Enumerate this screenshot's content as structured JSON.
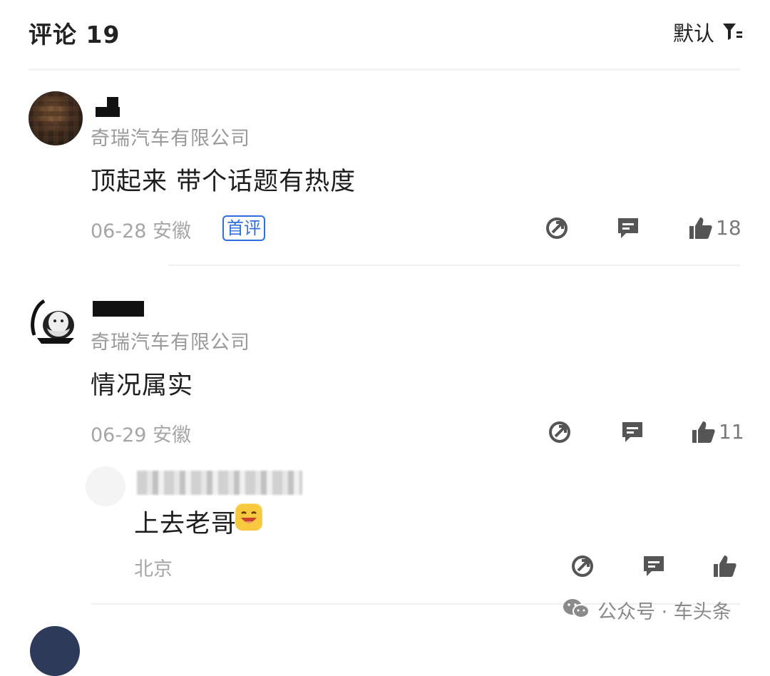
{
  "header": {
    "title": "评论 19",
    "sort_label": "默认"
  },
  "comments": [
    {
      "company": "奇瑞汽车有限公司",
      "text": "顶起来 带个话题有热度",
      "date_location": "06-28 安徽",
      "badge": "首评",
      "likes": "18"
    },
    {
      "company": "奇瑞汽车有限公司",
      "text": "情况属实",
      "date_location": "06-29 安徽",
      "likes": "11",
      "reply": {
        "text": "上去老哥",
        "location": "北京"
      }
    }
  ],
  "watermark": {
    "text": "公众号 · 车头条"
  },
  "colors": {
    "badge": "#2f6fe0",
    "meta": "#a6a6a6",
    "icon": "#555555"
  }
}
